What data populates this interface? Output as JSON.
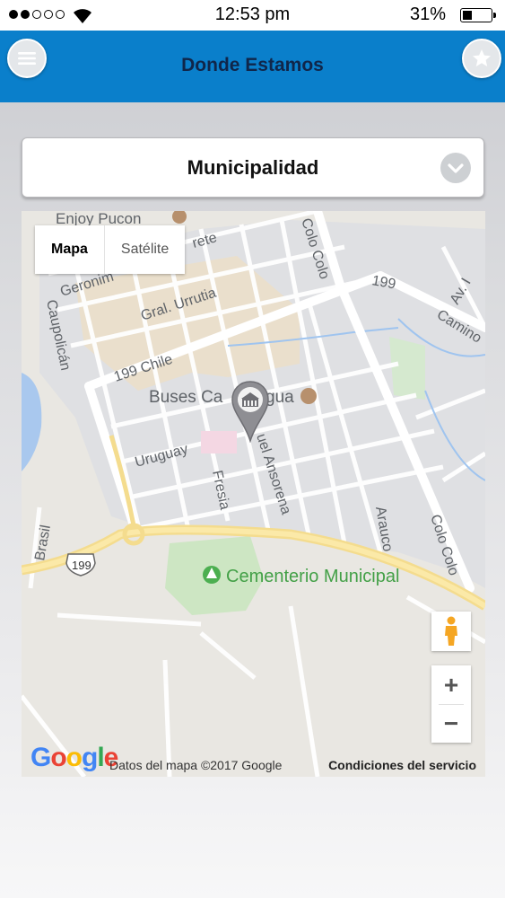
{
  "status_bar": {
    "time": "12:53 pm",
    "battery_percent": "31%",
    "signal_bars_filled": 2,
    "signal_bars_total": 5
  },
  "header": {
    "title": "Donde Estamos",
    "menu_icon": "hamburger-menu-icon",
    "favorite_icon": "star-icon",
    "background_color": "#0a7fcb"
  },
  "selector": {
    "selected_value": "Municipalidad",
    "icon": "chevron-down-icon"
  },
  "map": {
    "map_type_buttons": [
      {
        "label": "Mapa",
        "selected": true
      },
      {
        "label": "Satélite",
        "selected": false
      }
    ],
    "street_labels": {
      "enjoy": "Enjoy Pucon",
      "colo_colo_north": "Colo Colo",
      "rete": "rete",
      "geronimo": "Geronim",
      "urrutia": "Gral. Urrutia",
      "r199_east": "199",
      "av": "Av. I",
      "camino": "Camino",
      "caupolican": "Caupolicán",
      "chile": "199 Chile",
      "buses": "Buses Ca",
      "buses_end": "gua",
      "uruguay": "Uruguay",
      "ansorena": "uel Ansorena",
      "fresia": "Fresia",
      "arauco": "Arauco",
      "colo_colo_south": "Colo Colo",
      "brasil": "Brasil",
      "r199_shield": "199",
      "cementerio": "Cementerio Municipal"
    },
    "marker_icon": "municipal-building-pin-icon",
    "pegman_icon": "street-view-pegman-icon",
    "zoom_in_label": "+",
    "zoom_out_label": "−",
    "attribution": "Datos del mapa ©2017 Google",
    "terms": "Condiciones del servicio",
    "logo": "Google"
  }
}
